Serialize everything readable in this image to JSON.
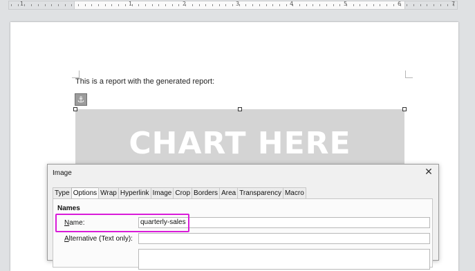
{
  "ruler": {
    "numbers": [
      "1",
      "1",
      "2",
      "3",
      "4",
      "5",
      "6",
      "7"
    ]
  },
  "document": {
    "body_text": "This is a report with the generated report:",
    "image_placeholder_text": "CHART HERE"
  },
  "dialog": {
    "title": "Image",
    "close_glyph": "✕",
    "tabs": [
      {
        "label": "Type"
      },
      {
        "label": "Options",
        "active": true
      },
      {
        "label": "Wrap"
      },
      {
        "label": "Hyperlink"
      },
      {
        "label": "Image"
      },
      {
        "label": "Crop"
      },
      {
        "label": "Borders"
      },
      {
        "label": "Area"
      },
      {
        "label": "Transparency"
      },
      {
        "label": "Macro"
      }
    ],
    "section_title": "Names",
    "fields": {
      "name": {
        "label": "Name:",
        "value": "quarterly-sales"
      },
      "alternative": {
        "label": "Alternative (Text only):",
        "value": ""
      },
      "description": {
        "value": ""
      }
    }
  },
  "colors": {
    "highlight": "#d91ad9",
    "placeholder_bg": "#d4d4d4"
  }
}
